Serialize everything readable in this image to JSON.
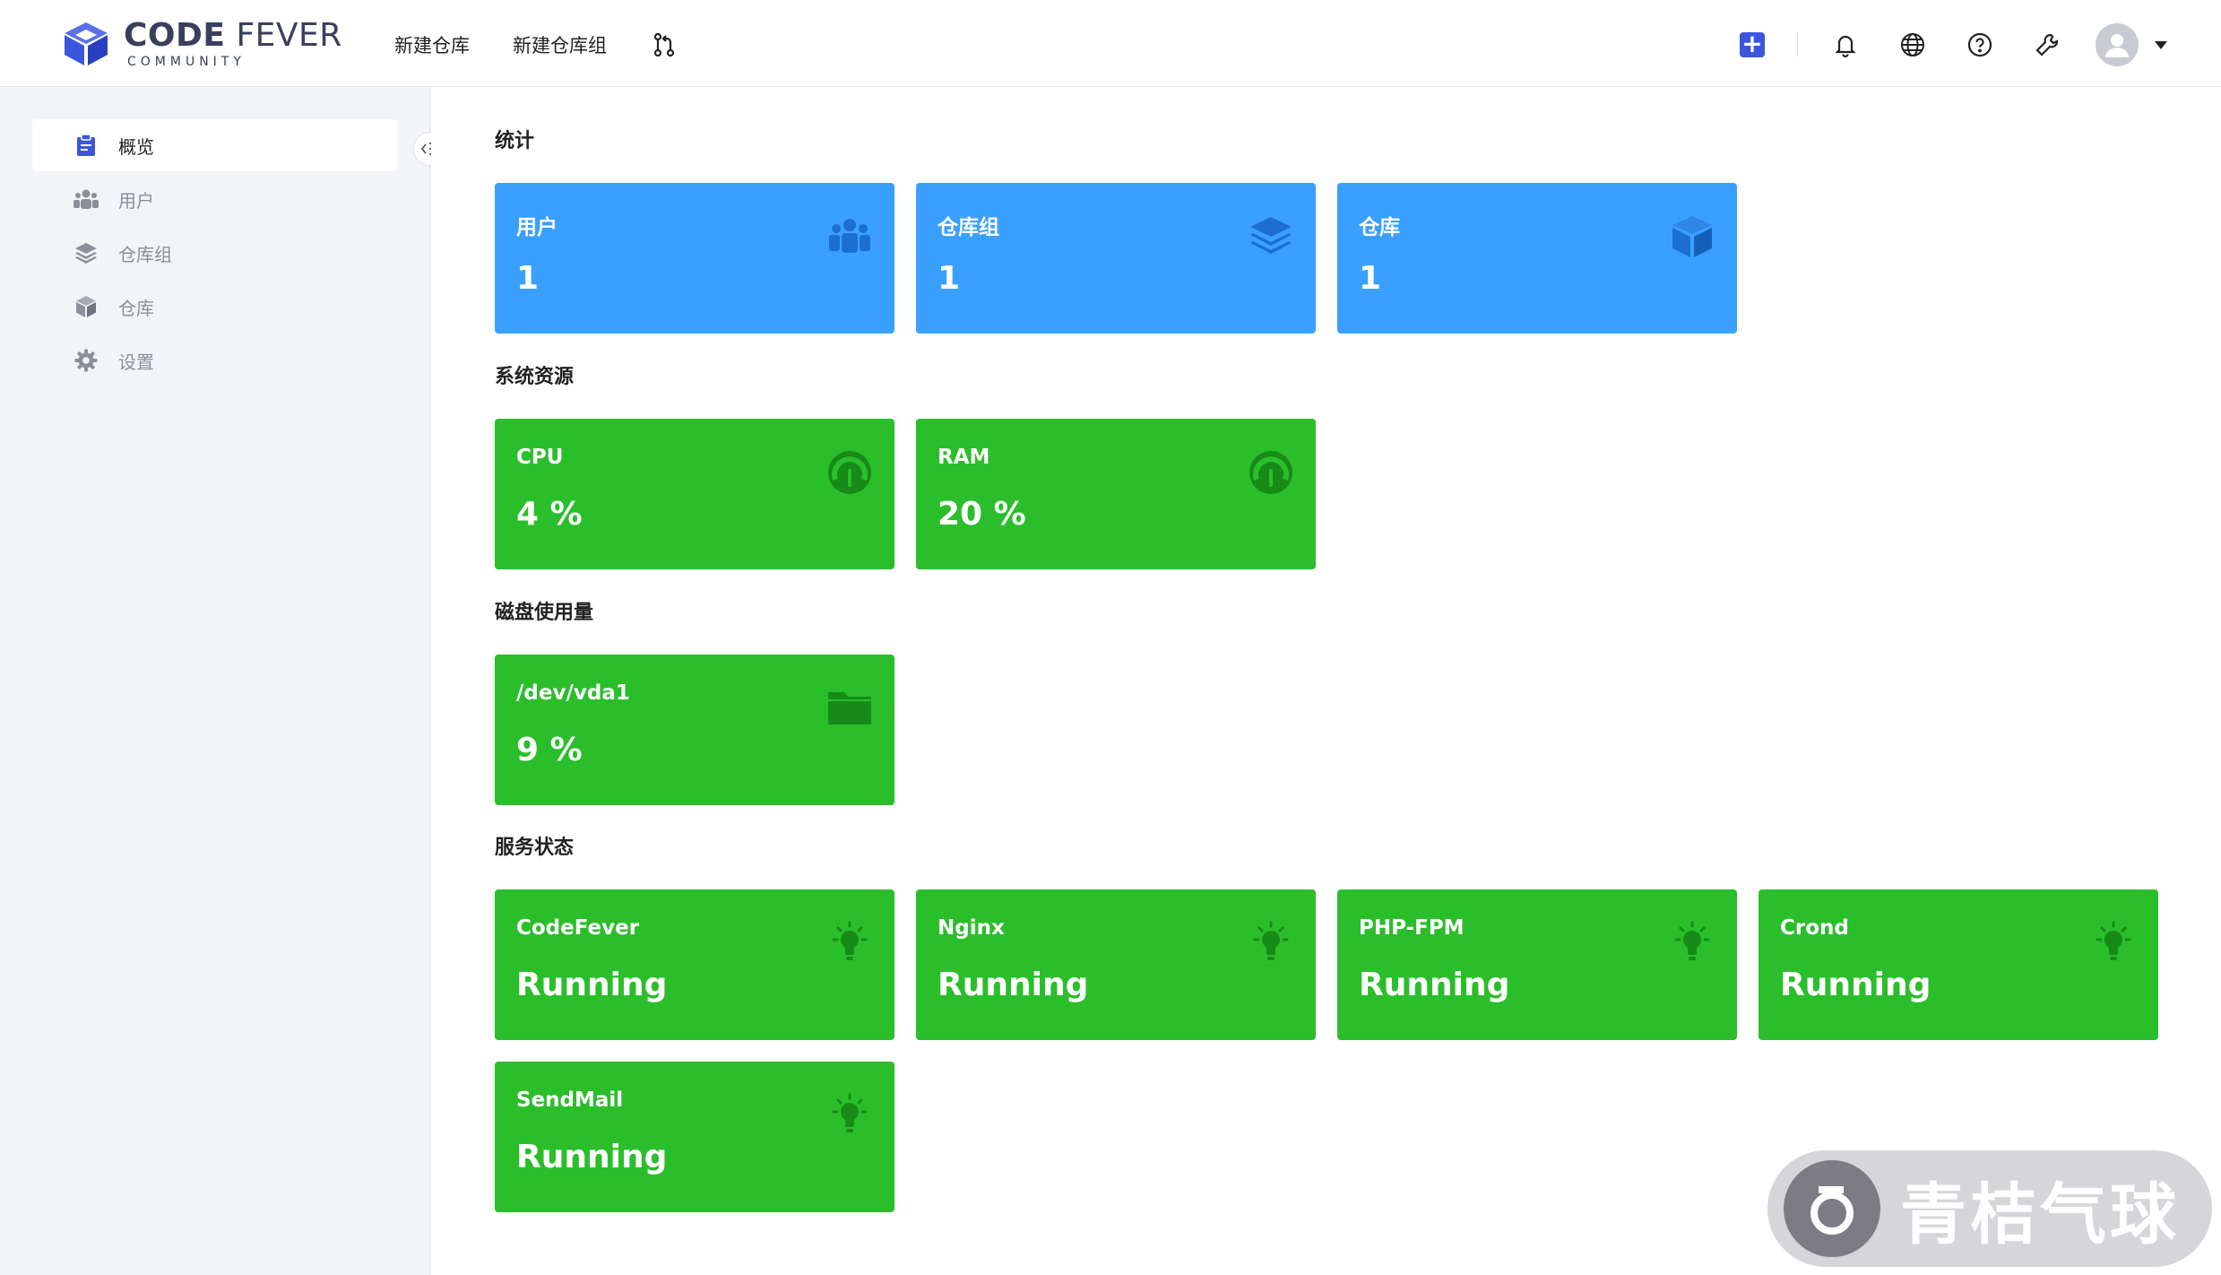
{
  "app": {
    "logo_main_bold": "CODE",
    "logo_main_light": "FEVER",
    "logo_sub": "COMMUNITY"
  },
  "topnav": {
    "new_repo": "新建仓库",
    "new_repo_group": "新建仓库组",
    "merge_request_icon": "git-merge-icon"
  },
  "tools": {
    "add_icon": "plus-square-icon",
    "bell_icon": "bell-icon",
    "globe_icon": "globe-icon",
    "help_icon": "question-circle-icon",
    "admin_icon": "wrench-icon",
    "avatar_icon": "user-avatar-icon"
  },
  "sidebar": {
    "items": [
      {
        "label": "概览",
        "icon": "clipboard-icon"
      },
      {
        "label": "用户",
        "icon": "users-icon"
      },
      {
        "label": "仓库组",
        "icon": "layers-icon"
      },
      {
        "label": "仓库",
        "icon": "cube-icon"
      },
      {
        "label": "设置",
        "icon": "gear-icon"
      }
    ]
  },
  "sections": {
    "stats": "统计",
    "resources": "系统资源",
    "disk": "磁盘使用量",
    "services": "服务状态"
  },
  "stats": [
    {
      "label": "用户",
      "value": "1",
      "icon": "users-icon"
    },
    {
      "label": "仓库组",
      "value": "1",
      "icon": "layers-icon"
    },
    {
      "label": "仓库",
      "value": "1",
      "icon": "cube-icon"
    }
  ],
  "resources": [
    {
      "label": "CPU",
      "value": "4 %",
      "icon": "gauge-icon"
    },
    {
      "label": "RAM",
      "value": "20 %",
      "icon": "gauge-icon"
    }
  ],
  "disk": [
    {
      "label": "/dev/vda1",
      "value": "9 %",
      "icon": "folder-icon"
    }
  ],
  "services": [
    {
      "label": "CodeFever",
      "value": "Running",
      "icon": "lightbulb-icon"
    },
    {
      "label": "Nginx",
      "value": "Running",
      "icon": "lightbulb-icon"
    },
    {
      "label": "PHP-FPM",
      "value": "Running",
      "icon": "lightbulb-icon"
    },
    {
      "label": "Crond",
      "value": "Running",
      "icon": "lightbulb-icon"
    },
    {
      "label": "SendMail",
      "value": "Running",
      "icon": "lightbulb-icon"
    }
  ],
  "colors": {
    "blue_card": "#3aa0ff",
    "green_card": "#2bbe2b",
    "accent": "#3c55dd"
  },
  "watermark": {
    "text": "青桔气球"
  }
}
